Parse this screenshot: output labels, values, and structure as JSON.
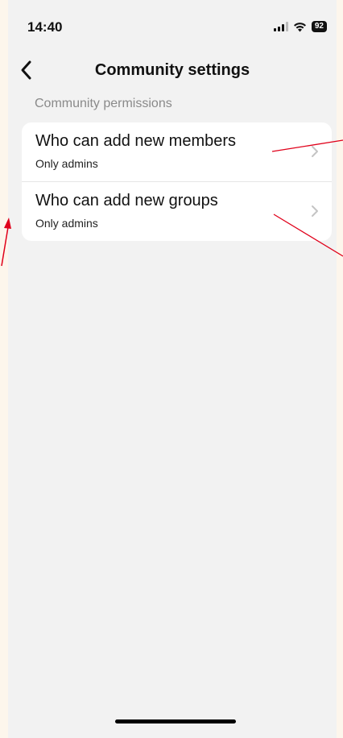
{
  "status_bar": {
    "time": "14:40",
    "battery": "92",
    "icons": [
      "signal-icon",
      "wifi-icon",
      "battery-icon"
    ]
  },
  "nav": {
    "title": "Community settings",
    "back_icon": "chevron-left-icon"
  },
  "section": {
    "header": "Community permissions"
  },
  "settings": [
    {
      "title": "Who can add new members",
      "value": "Only admins"
    },
    {
      "title": "Who can add new groups",
      "value": "Only admins"
    }
  ],
  "colors": {
    "background": "#f2f2f2",
    "card": "#ffffff",
    "outer_background": "#fdf6ec",
    "annotation": "#e0001a"
  }
}
